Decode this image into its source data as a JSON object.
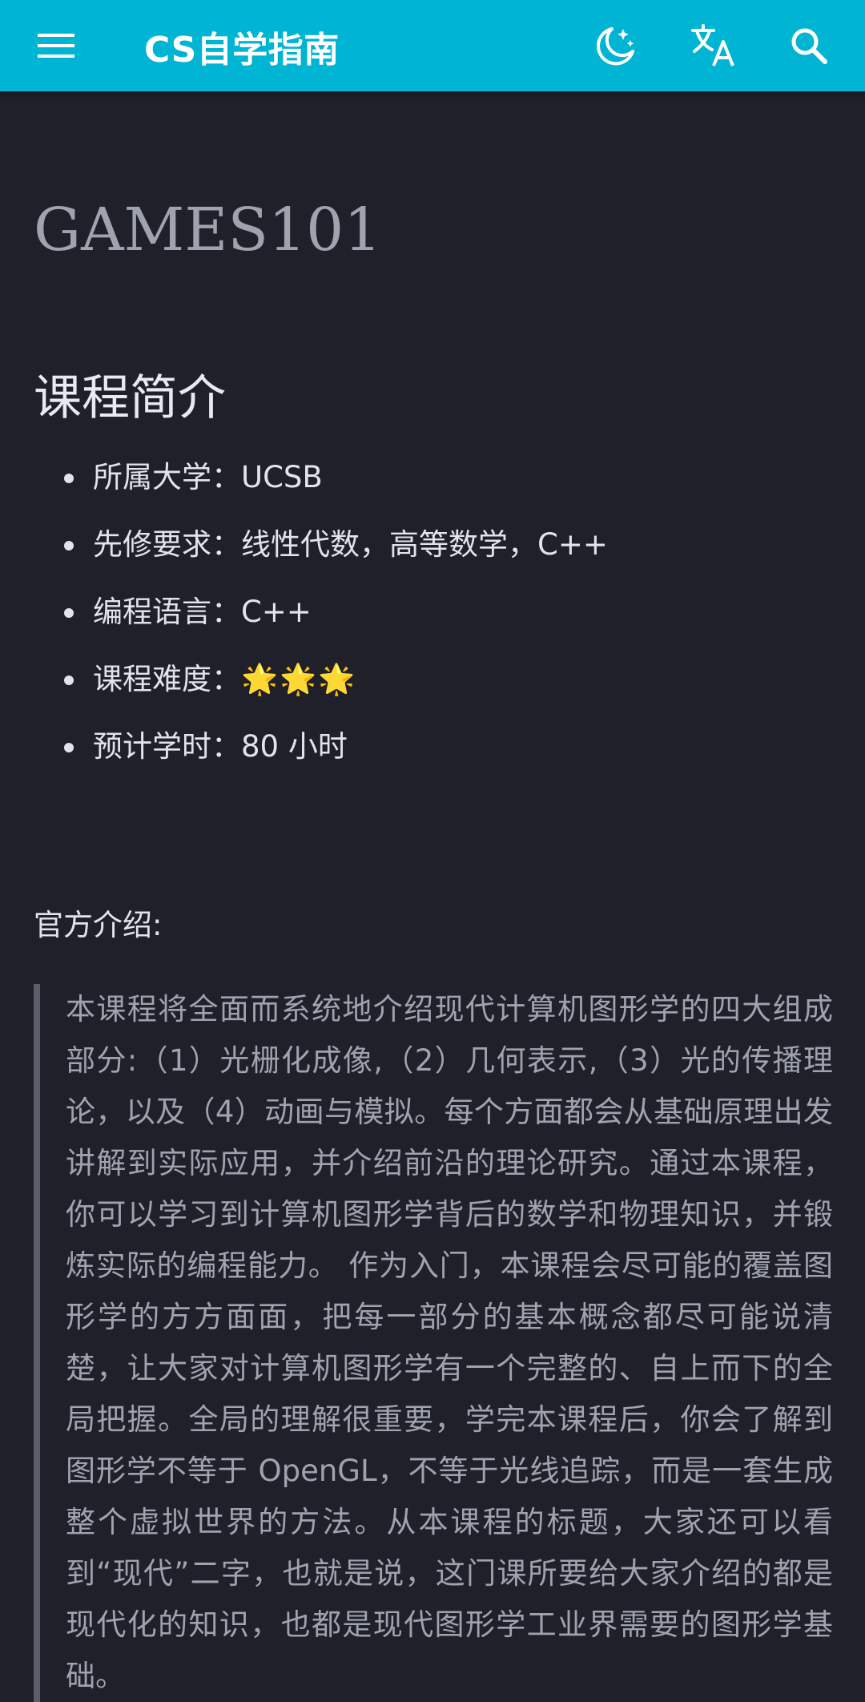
{
  "header": {
    "title": "CS自学指南",
    "icons": [
      "menu-icon",
      "theme-toggle-icon",
      "translate-icon",
      "search-icon"
    ],
    "background": "#00b4d3"
  },
  "page": {
    "title": "GAMES101",
    "section_title": "课程简介",
    "info": [
      {
        "label": "所属大学：",
        "value": "UCSB"
      },
      {
        "label": "先修要求：",
        "value": "线性代数，高等数学，C++"
      },
      {
        "label": "编程语言：",
        "value": "C++"
      },
      {
        "label": "课程难度：",
        "value": "🌟🌟🌟"
      },
      {
        "label": "预计学时：",
        "value": "80 小时"
      }
    ],
    "official_label": "官方介绍:",
    "intro": "本课程将全面而系统地介绍现代计算机图形学的四大组成部分:（1）光栅化成像,（2）几何表示,（3）光的传播理论，以及（4）动画与模拟。每个方面都会从基础原理出发讲解到实际应用，并介绍前沿的理论研究。通过本课程，你可以学习到计算机图形学背后的数学和物理知识，并锻炼实际的编程能力。 作为入门，本课程会尽可能的覆盖图形学的方方面面，把每一部分的基本概念都尽可能说清楚，让大家对计算机图形学有一个完整的、自上而下的全局把握。全局的理解很重要，学完本课程后，你会了解到图形学不等于 OpenGL，不等于光线追踪，而是一套生成整个虚拟世界的方法。从本课程的标题，大家还可以看到“现代”二字，也就是说，这门课所要给大家介绍的都是现代化的知识，也都是现代图形学工业界需要的图形学基础。"
  }
}
